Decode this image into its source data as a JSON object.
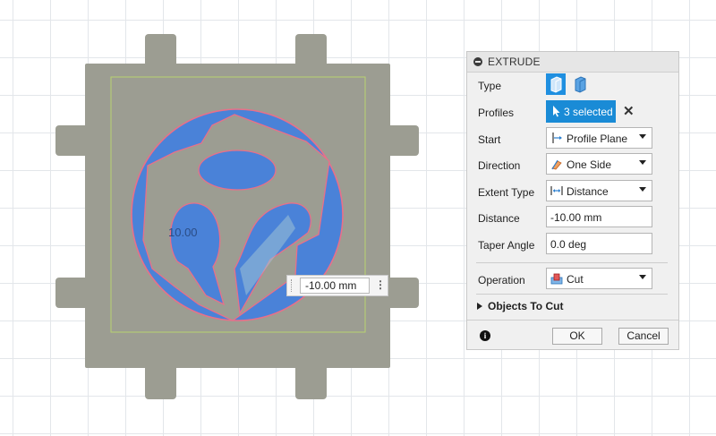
{
  "canvas": {
    "dimension_label": "10.00",
    "dimension_input": "-10.00 mm",
    "more_icon": "vertical-dots-icon"
  },
  "dialog": {
    "title": "EXTRUDE",
    "rows": {
      "type_label": "Type",
      "profiles_label": "Profiles",
      "profiles_value": "3 selected",
      "start_label": "Start",
      "start_value": "Profile Plane",
      "direction_label": "Direction",
      "direction_value": "One Side",
      "extent_label": "Extent Type",
      "extent_value": "Distance",
      "distance_label": "Distance",
      "distance_value": "-10.00 mm",
      "taper_label": "Taper Angle",
      "taper_value": "0.0 deg",
      "operation_label": "Operation",
      "operation_value": "Cut"
    },
    "objects_to_cut": "Objects To Cut",
    "ok": "OK",
    "cancel": "Cancel"
  },
  "colors": {
    "body": "#9c9d92",
    "profile_fill": "#4a82d8",
    "profile_edge": "#e0607a",
    "accent": "#1a8bd6"
  }
}
